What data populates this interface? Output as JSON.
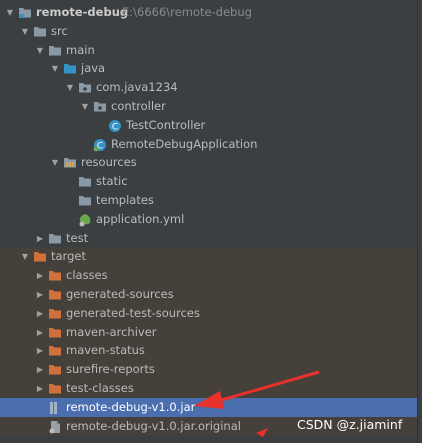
{
  "project": {
    "name": "remote-debug",
    "path": "E:\\6666\\remote-debug"
  },
  "tree": [
    {
      "label": "remote-debug",
      "depth": 0,
      "expanded": true,
      "icon": "module-folder-icon",
      "bold": true
    },
    {
      "label": "src",
      "depth": 1,
      "expanded": true,
      "icon": "folder-icon"
    },
    {
      "label": "main",
      "depth": 2,
      "expanded": true,
      "icon": "folder-icon"
    },
    {
      "label": "java",
      "depth": 3,
      "expanded": true,
      "icon": "source-folder-icon"
    },
    {
      "label": "com.java1234",
      "depth": 4,
      "expanded": true,
      "icon": "package-icon"
    },
    {
      "label": "controller",
      "depth": 5,
      "expanded": true,
      "icon": "package-icon"
    },
    {
      "label": "TestController",
      "depth": 6,
      "expanded": null,
      "icon": "class-icon"
    },
    {
      "label": "RemoteDebugApplication",
      "depth": 5,
      "expanded": null,
      "icon": "spring-class-icon"
    },
    {
      "label": "resources",
      "depth": 3,
      "expanded": true,
      "icon": "resources-folder-icon"
    },
    {
      "label": "static",
      "depth": 4,
      "expanded": null,
      "icon": "folder-icon"
    },
    {
      "label": "templates",
      "depth": 4,
      "expanded": null,
      "icon": "folder-icon"
    },
    {
      "label": "application.yml",
      "depth": 4,
      "expanded": null,
      "icon": "yaml-file-icon"
    },
    {
      "label": "test",
      "depth": 2,
      "expanded": false,
      "icon": "folder-icon"
    },
    {
      "label": "target",
      "depth": 1,
      "expanded": true,
      "icon": "excluded-folder-icon",
      "target": true
    },
    {
      "label": "classes",
      "depth": 2,
      "expanded": false,
      "icon": "excluded-folder-icon",
      "target": true
    },
    {
      "label": "generated-sources",
      "depth": 2,
      "expanded": false,
      "icon": "excluded-folder-icon",
      "target": true
    },
    {
      "label": "generated-test-sources",
      "depth": 2,
      "expanded": false,
      "icon": "excluded-folder-icon",
      "target": true
    },
    {
      "label": "maven-archiver",
      "depth": 2,
      "expanded": false,
      "icon": "excluded-folder-icon",
      "target": true
    },
    {
      "label": "maven-status",
      "depth": 2,
      "expanded": false,
      "icon": "excluded-folder-icon",
      "target": true
    },
    {
      "label": "surefire-reports",
      "depth": 2,
      "expanded": false,
      "icon": "excluded-folder-icon",
      "target": true
    },
    {
      "label": "test-classes",
      "depth": 2,
      "expanded": false,
      "icon": "excluded-folder-icon",
      "target": true
    },
    {
      "label": "remote-debug-v1.0.jar",
      "depth": 2,
      "expanded": null,
      "icon": "jar-icon",
      "target": true,
      "selected": true
    },
    {
      "label": "remote-debug-v1.0.jar.original",
      "depth": 2,
      "expanded": null,
      "icon": "file-icon",
      "target": true
    }
  ],
  "watermark": "CSDN @z.jiaminf",
  "colors": {
    "selection": "#4b6eaf",
    "folder": "#8a99a6",
    "excluded_folder": "#d0703a",
    "source_folder": "#3592c4",
    "annotation_arrow": "#e8312a"
  }
}
